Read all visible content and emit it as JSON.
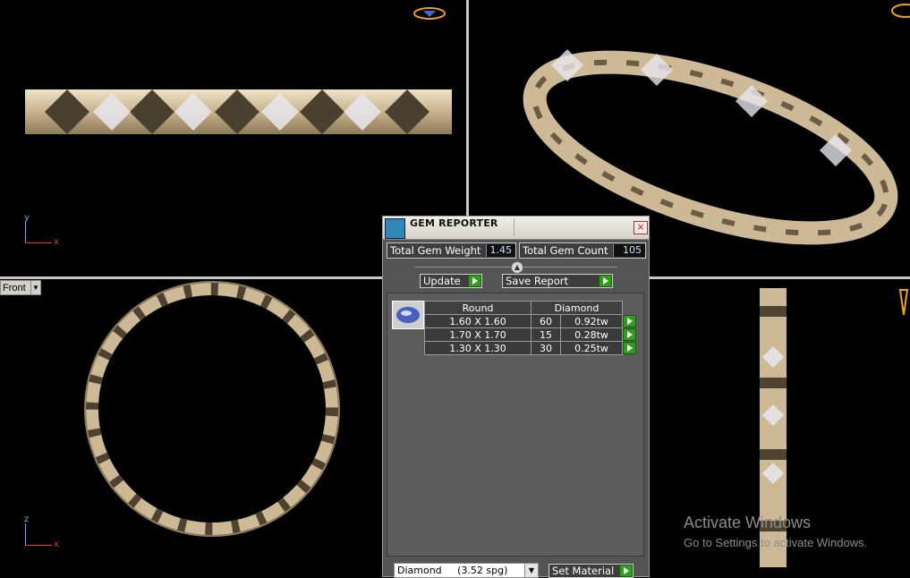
{
  "viewports": {
    "top_left": {
      "axis_y": "y",
      "axis_x": "x"
    },
    "bottom_left": {
      "view_label": "Front",
      "axis_z": "z",
      "axis_x": "x"
    }
  },
  "gem_reporter": {
    "title": "GEM REPORTER",
    "close_label": "×",
    "total_weight_label": "Total Gem Weight",
    "total_weight_value": "1.45",
    "total_count_label": "Total Gem Count",
    "total_count_value": "105",
    "update_label": "Update",
    "save_report_label": "Save Report",
    "table": {
      "headers": [
        "Round",
        "Diamond"
      ],
      "rows": [
        {
          "size": "1.60 X 1.60",
          "count": "60",
          "weight": "0.92tw"
        },
        {
          "size": "1.70 X 1.70",
          "count": "15",
          "weight": "0.28tw"
        },
        {
          "size": "1.30 X 1.30",
          "count": "30",
          "weight": "0.25tw"
        }
      ]
    },
    "material_value": "Diamond     (3.52 spg)",
    "set_material_label": "Set Material"
  },
  "watermark": {
    "line1": "Activate Windows",
    "line2": "Go to Settings to activate Windows."
  },
  "colors": {
    "metal": "#d6c3a3",
    "panel": "#545454",
    "accent_green": "#2f9e1d"
  }
}
